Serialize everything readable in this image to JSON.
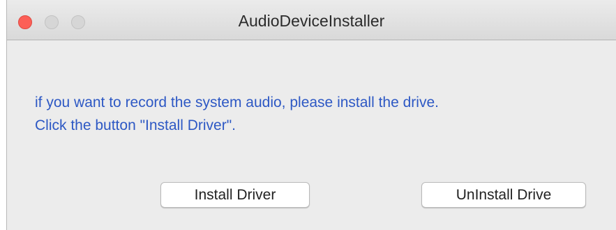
{
  "window": {
    "title": "AudioDeviceInstaller"
  },
  "message": {
    "line1": "if you want to record the system audio, please install the drive.",
    "line2": "Click the button \"Install Driver\"."
  },
  "buttons": {
    "install_label": "Install Driver",
    "uninstall_label": "UnInstall Drive"
  },
  "colors": {
    "message_text": "#2d58c4",
    "close_button": "#fc5f57",
    "window_background": "#ececec"
  }
}
